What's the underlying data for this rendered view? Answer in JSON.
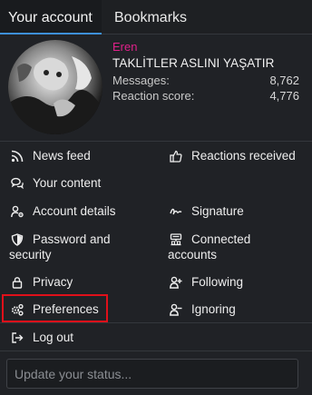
{
  "tabs": [
    {
      "label": "Your account",
      "active": true
    },
    {
      "label": "Bookmarks",
      "active": false
    }
  ],
  "profile": {
    "name": "Eren",
    "name_color": "#e0218a",
    "title": "TAKLİTLER ASLINI YAŞATIR",
    "stats": [
      {
        "label": "Messages:",
        "value": "8,762"
      },
      {
        "label": "Reaction score:",
        "value": "4,776"
      }
    ]
  },
  "menu": {
    "news_feed": "News feed",
    "your_content": "Your content",
    "reactions_received": "Reactions received",
    "account_details": "Account details",
    "signature": "Signature",
    "password_line1": "Password and",
    "password_line2": "security",
    "connected_line1": "Connected",
    "connected_line2": "accounts",
    "privacy": "Privacy",
    "following": "Following",
    "preferences": "Preferences",
    "ignoring": "Ignoring",
    "log_out": "Log out"
  },
  "status": {
    "placeholder": "Update your status..."
  },
  "colors": {
    "accent": "#3d90d8",
    "highlight": "#e0101a"
  },
  "icons": {
    "news_feed": "rss-icon",
    "your_content": "comments-icon",
    "reactions_received": "thumbs-up-icon",
    "account_details": "user-cog-icon",
    "signature": "signature-icon",
    "password_security": "shield-icon",
    "connected_accounts": "connected-accounts-icon",
    "privacy": "lock-icon",
    "following": "user-plus-icon",
    "preferences": "cogs-icon",
    "ignoring": "user-minus-icon",
    "log_out": "sign-out-icon"
  }
}
